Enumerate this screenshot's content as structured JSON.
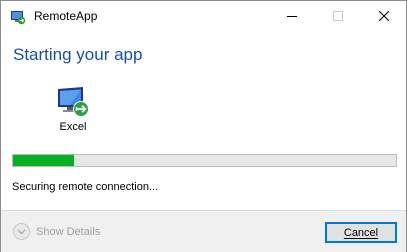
{
  "window": {
    "title": "RemoteApp",
    "app_icon": "remoteapp-icon"
  },
  "titlebar": {
    "minimize_icon": "minimize-icon",
    "maximize_icon": "maximize-icon",
    "close_icon": "close-icon"
  },
  "main": {
    "heading": "Starting your app",
    "app": {
      "name": "Excel",
      "icon": "remote-desktop-icon"
    },
    "progress": {
      "value": 0.16,
      "color": "#06b025"
    },
    "status": "Securing remote connection..."
  },
  "footer": {
    "details_label": "Show Details",
    "details_icon": "chevron-down-icon",
    "cancel_label": "Cancel"
  },
  "colors": {
    "heading": "#1a4fa0",
    "accent": "#0078d7"
  }
}
